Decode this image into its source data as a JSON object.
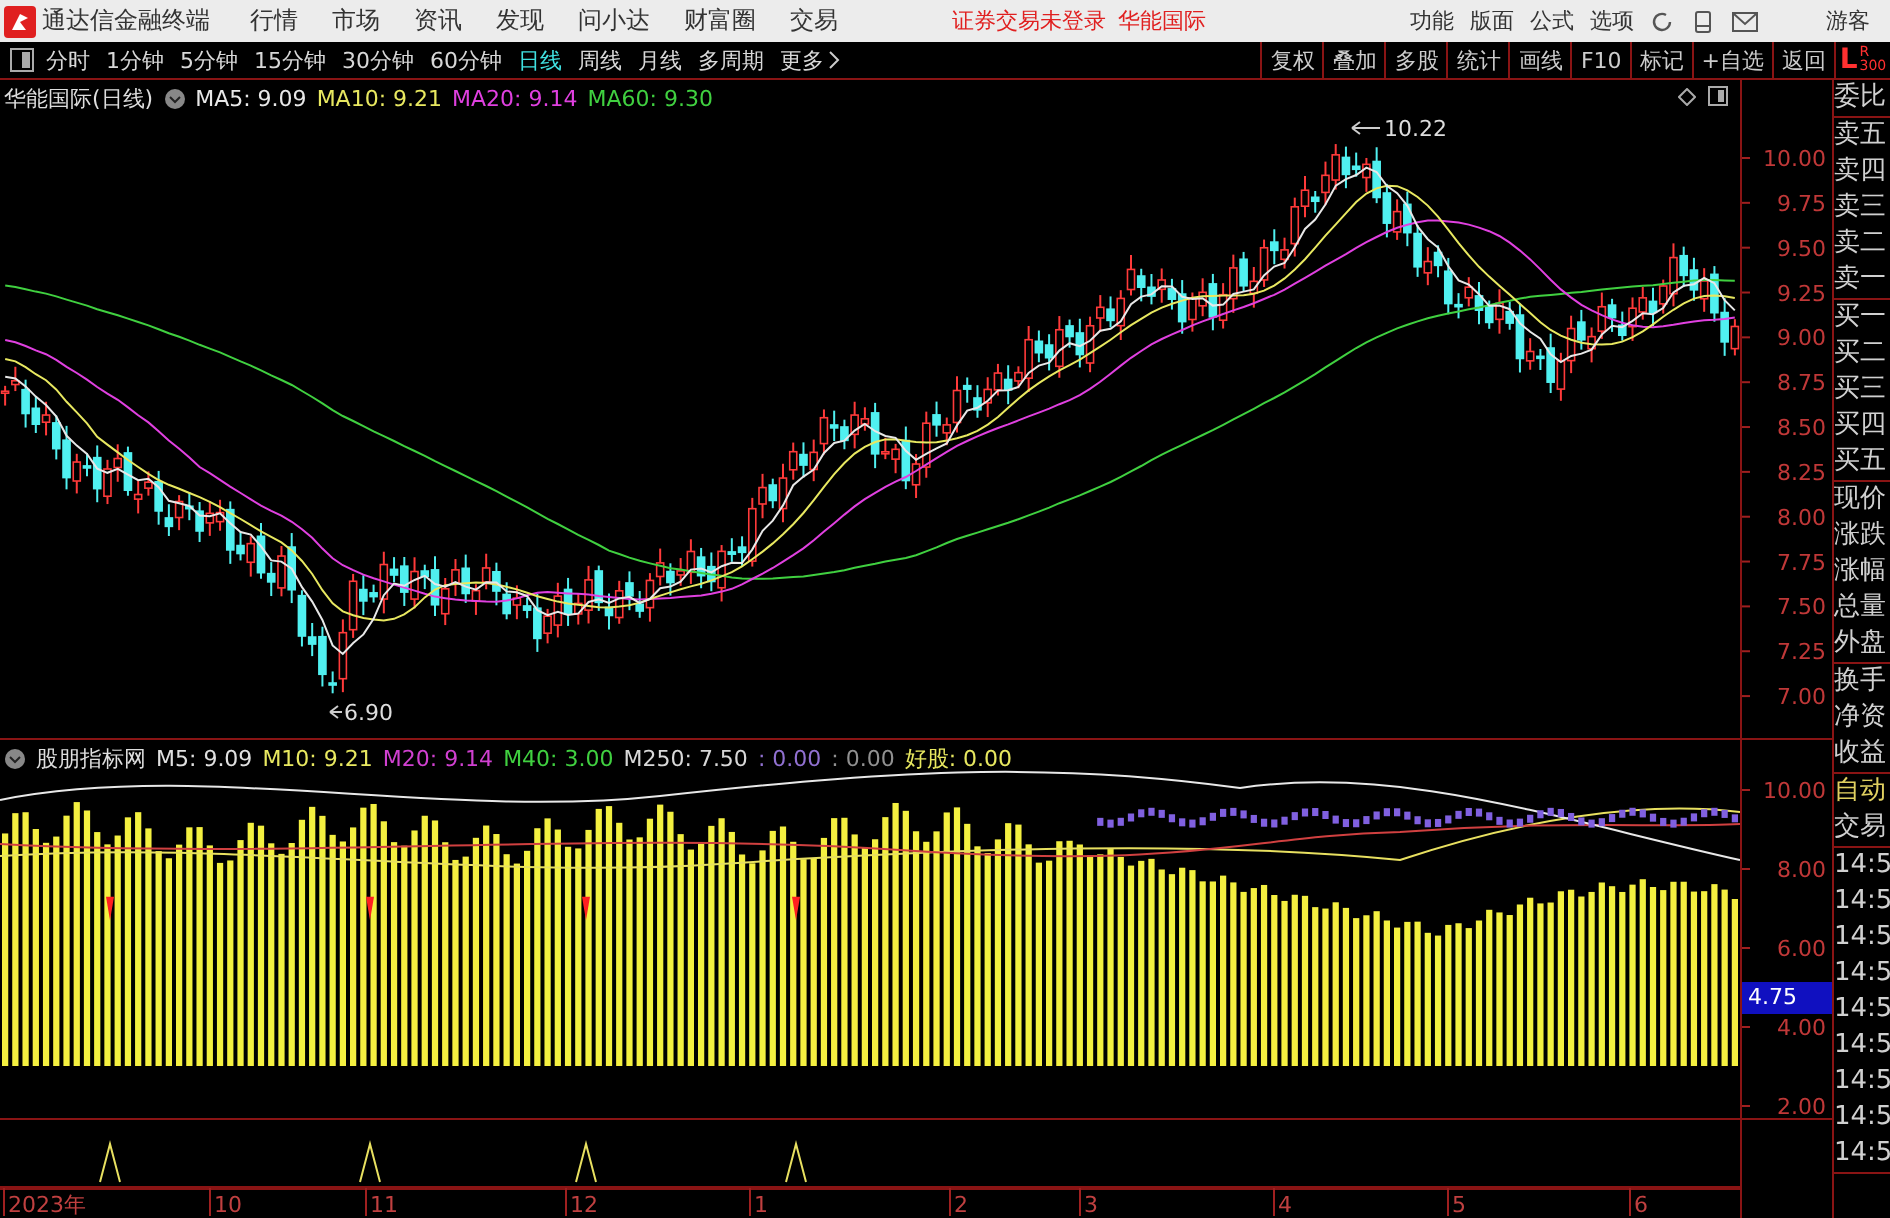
{
  "app": {
    "title": "通达信金融终端"
  },
  "menu": [
    "行情",
    "市场",
    "资讯",
    "发现",
    "问小达",
    "财富圈",
    "交易"
  ],
  "status": [
    "证券交易未登录",
    "华能国际"
  ],
  "right_menu": [
    "功能",
    "版面",
    "公式",
    "选项"
  ],
  "user": "游客",
  "periods": [
    {
      "label": "分时",
      "selected": false
    },
    {
      "label": "1分钟",
      "selected": false
    },
    {
      "label": "5分钟",
      "selected": false
    },
    {
      "label": "15分钟",
      "selected": false
    },
    {
      "label": "30分钟",
      "selected": false
    },
    {
      "label": "60分钟",
      "selected": false
    },
    {
      "label": "日线",
      "selected": true
    },
    {
      "label": "周线",
      "selected": false
    },
    {
      "label": "月线",
      "selected": false
    },
    {
      "label": "多周期",
      "selected": false
    },
    {
      "label": "更多",
      "selected": false
    }
  ],
  "tools": [
    "复权",
    "叠加",
    "多股",
    "统计",
    "画线",
    "F10",
    "标记",
    "+自选",
    "返回"
  ],
  "level_badge": {
    "main": "L",
    "sub": "R",
    "depth": "300"
  },
  "main_chart": {
    "title": "华能国际(日线)",
    "legend": [
      {
        "text": "MA5: 9.09",
        "color": "#e8e8e8"
      },
      {
        "text": "MA10: 9.21",
        "color": "#e8e860"
      },
      {
        "text": "MA20: 9.14",
        "color": "#e040e0"
      },
      {
        "text": "MA60: 9.30",
        "color": "#40d040"
      }
    ],
    "price_ticks": [
      "10.00",
      "9.75",
      "9.50",
      "9.25",
      "9.00",
      "8.75",
      "8.50",
      "8.25",
      "8.00",
      "7.75",
      "7.50",
      "7.25",
      "7.00"
    ],
    "high_label": "10.22",
    "low_label": "6.90"
  },
  "indicator": {
    "title": "股朋指标网",
    "legend": [
      {
        "text": "M5: 9.09",
        "color": "#e0e0e0"
      },
      {
        "text": "M10: 9.21",
        "color": "#e8e860"
      },
      {
        "text": "M20: 9.14",
        "color": "#d040d0"
      },
      {
        "text": "M40: 3.00",
        "color": "#40d040"
      },
      {
        "text": "M250: 7.50",
        "color": "#d8d8d8"
      },
      {
        "text": ": 0.00",
        "color": "#9070d0"
      },
      {
        "text": ": 0.00",
        "color": "#909090"
      },
      {
        "text": "好股: 0.00",
        "color": "#e8e860"
      }
    ],
    "ticks": [
      "10.00",
      "8.00",
      "6.00",
      "4.00",
      "2.00"
    ],
    "cursor_value": "4.75"
  },
  "time_axis": [
    "2023年",
    "10",
    "11",
    "12",
    "1",
    "2",
    "3",
    "4",
    "5",
    "6"
  ],
  "side_panel": [
    {
      "items": [
        {
          "text": "委比",
          "highlight": false
        }
      ]
    },
    {
      "items": [
        {
          "text": "卖五",
          "highlight": false
        },
        {
          "text": "卖四",
          "highlight": false
        },
        {
          "text": "卖三",
          "highlight": false
        },
        {
          "text": "卖二",
          "highlight": false
        },
        {
          "text": "卖一",
          "highlight": false
        }
      ]
    },
    {
      "items": [
        {
          "text": "买一",
          "highlight": false
        },
        {
          "text": "买二",
          "highlight": false
        },
        {
          "text": "买三",
          "highlight": false
        },
        {
          "text": "买四",
          "highlight": false
        },
        {
          "text": "买五",
          "highlight": false
        }
      ]
    },
    {
      "items": [
        {
          "text": "现价",
          "highlight": false
        },
        {
          "text": "涨跌",
          "highlight": false
        },
        {
          "text": "涨幅",
          "highlight": false
        },
        {
          "text": "总量",
          "highlight": false
        },
        {
          "text": "外盘",
          "highlight": false
        }
      ]
    },
    {
      "items": [
        {
          "text": "换手",
          "highlight": false
        },
        {
          "text": "净资",
          "highlight": false
        },
        {
          "text": "收益",
          "highlight": false
        }
      ]
    },
    {
      "items": [
        {
          "text": "自动",
          "highlight": true
        },
        {
          "text": "交易",
          "highlight": false
        }
      ]
    },
    {
      "items": [
        {
          "text": "14:5",
          "highlight": false
        },
        {
          "text": "14:5",
          "highlight": false
        },
        {
          "text": "14:5",
          "highlight": false
        },
        {
          "text": "14:5",
          "highlight": false
        },
        {
          "text": "14:5",
          "highlight": false
        },
        {
          "text": "14:5",
          "highlight": false
        },
        {
          "text": "14:5",
          "highlight": false
        },
        {
          "text": "14:5",
          "highlight": false
        },
        {
          "text": "14:5",
          "highlight": false
        }
      ]
    }
  ]
}
